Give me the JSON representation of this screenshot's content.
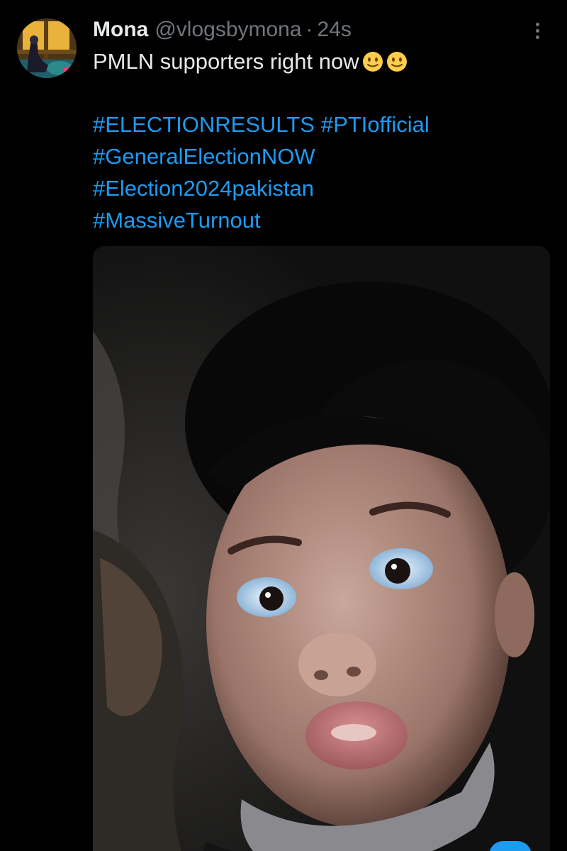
{
  "tweet": {
    "display_name": "Mona",
    "handle": "@vlogsbymona",
    "separator": "·",
    "timestamp": "24s",
    "text": "PMLN supporters right now",
    "emojis": [
      "slightly-smiling-face",
      "slightly-smiling-face"
    ],
    "hashtag_lines": [
      [
        "#ELECTIONRESULTS",
        "#PTIofficial"
      ],
      [
        "#GeneralElectionNOW"
      ],
      [
        "#Election2024pakistan"
      ],
      [
        "#MassiveTurnout"
      ]
    ]
  },
  "icons": {
    "more": "more-vertical-icon",
    "emoji": "slightly-smiling-face-icon"
  },
  "colors": {
    "background": "#000000",
    "primary_text": "#e7e9ea",
    "secondary_text": "#71767b",
    "hashtag": "#1d9bf0"
  }
}
